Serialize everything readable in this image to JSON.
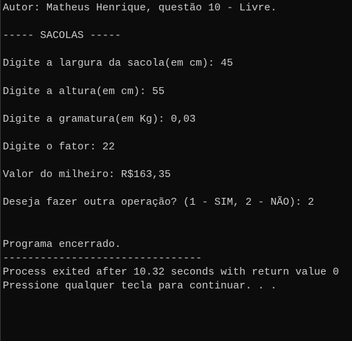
{
  "console": {
    "lines": [
      "Autor: Matheus Henrique, questão 10 - Livre.",
      "",
      "----- SACOLAS -----",
      "",
      "Digite a largura da sacola(em cm): 45",
      "",
      "Digite a altura(em cm): 55",
      "",
      "Digite a gramatura(em Kg): 0,03",
      "",
      "Digite o fator: 22",
      "",
      "Valor do milheiro: R$163,35",
      "",
      "Deseja fazer outra operação? (1 - SIM, 2 - NÃO): 2",
      "",
      "",
      "Programa encerrado.",
      "--------------------------------",
      "Process exited after 10.32 seconds with return value 0",
      "Pressione qualquer tecla para continuar. . ."
    ]
  },
  "colors": {
    "background": "#0c0c0c",
    "text": "#cccccc"
  }
}
